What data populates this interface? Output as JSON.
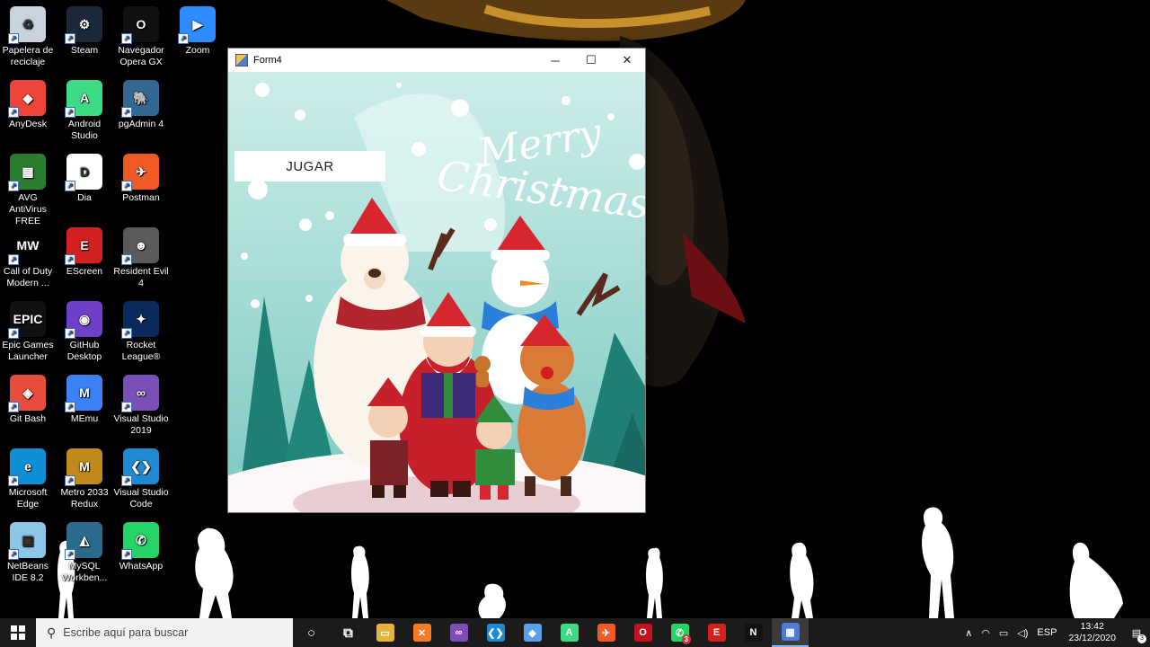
{
  "desktop": {
    "icons": [
      {
        "label": "Papelera de reciclaje",
        "icon": "recycle-bin-icon",
        "color": "#c9d3dc"
      },
      {
        "label": "Steam",
        "icon": "steam-icon",
        "color": "#1b2838"
      },
      {
        "label": "Navegador Opera GX",
        "icon": "opera-gx-icon",
        "color": "#111111"
      },
      {
        "label": "Zoom",
        "icon": "zoom-icon",
        "color": "#2d8cff"
      },
      {
        "label": "AnyDesk",
        "icon": "anydesk-icon",
        "color": "#ef443b"
      },
      {
        "label": "Android Studio",
        "icon": "android-studio-icon",
        "color": "#3ddc84"
      },
      {
        "label": "pgAdmin 4",
        "icon": "pgadmin-icon",
        "color": "#336791"
      },
      {
        "label": "AVG AntiVirus FREE",
        "icon": "avg-icon",
        "color": "#2a7d2f"
      },
      {
        "label": "Dia",
        "icon": "dia-icon",
        "color": "#ffffff"
      },
      {
        "label": "Postman",
        "icon": "postman-icon",
        "color": "#ef5b25"
      },
      {
        "label": "Call of Duty Modern ...",
        "icon": "call-of-duty-icon",
        "color": "#000000"
      },
      {
        "label": "EScreen",
        "icon": "escreen-icon",
        "color": "#d21f1f"
      },
      {
        "label": "Resident Evil 4",
        "icon": "resident-evil-icon",
        "color": "#5a5a5a"
      },
      {
        "label": "Epic Games Launcher",
        "icon": "epic-games-icon",
        "color": "#111111"
      },
      {
        "label": "GitHub Desktop",
        "icon": "github-desktop-icon",
        "color": "#6e40c9"
      },
      {
        "label": "Rocket League®",
        "icon": "rocket-league-icon",
        "color": "#0a2a5c"
      },
      {
        "label": "Git Bash",
        "icon": "git-bash-icon",
        "color": "#e74c3c"
      },
      {
        "label": "MEmu",
        "icon": "memu-icon",
        "color": "#3b82f6"
      },
      {
        "label": "Visual Studio 2019",
        "icon": "visual-studio-icon",
        "color": "#7b4fb8"
      },
      {
        "label": "Microsoft Edge",
        "icon": "edge-icon",
        "color": "#0f8fd8"
      },
      {
        "label": "Metro 2033 Redux",
        "icon": "metro-icon",
        "color": "#c28a1c"
      },
      {
        "label": "Visual Studio Code",
        "icon": "vscode-icon",
        "color": "#1f8ad2"
      },
      {
        "label": "NetBeans IDE 8.2",
        "icon": "netbeans-icon",
        "color": "#8ec6e8"
      },
      {
        "label": "MySQL Workben...",
        "icon": "mysql-workbench-icon",
        "color": "#2a6b8c"
      },
      {
        "label": "WhatsApp",
        "icon": "whatsapp-icon",
        "color": "#25d366"
      }
    ]
  },
  "window": {
    "title": "Form4",
    "minimize": "─",
    "maximize": "☐",
    "close": "✕",
    "button_label": "JUGAR",
    "banner_line1": "Merry",
    "banner_line2": "Christmas"
  },
  "taskbar": {
    "search_placeholder": "Escribe aquí para buscar",
    "apps": [
      {
        "icon": "cortana-icon",
        "glyph": "○",
        "bg": "transparent"
      },
      {
        "icon": "task-view-icon",
        "glyph": "⧉",
        "bg": "transparent"
      },
      {
        "icon": "file-explorer-icon",
        "glyph": "▭",
        "bg": "#e8b23a"
      },
      {
        "icon": "xampp-icon",
        "glyph": "✕",
        "bg": "#f57c20"
      },
      {
        "icon": "visual-studio-taskbar-icon",
        "glyph": "∞",
        "bg": "#7b4fb8"
      },
      {
        "icon": "vscode-taskbar-icon",
        "glyph": "❮❯",
        "bg": "#1f8ad2"
      },
      {
        "icon": "virtualbox-icon",
        "glyph": "◆",
        "bg": "#5aa0e8"
      },
      {
        "icon": "android-studio-taskbar-icon",
        "glyph": "A",
        "bg": "#3ddc84"
      },
      {
        "icon": "postman-taskbar-icon",
        "glyph": "✈",
        "bg": "#ef5b25"
      },
      {
        "icon": "opera-gx-taskbar-icon",
        "glyph": "O",
        "bg": "#c5121e"
      },
      {
        "icon": "whatsapp-taskbar-icon",
        "glyph": "✆",
        "bg": "#25d366",
        "badge": "3"
      },
      {
        "icon": "escreen-taskbar-icon",
        "glyph": "E",
        "bg": "#d21f1f"
      },
      {
        "icon": "netflix-icon",
        "glyph": "N",
        "bg": "#111111"
      },
      {
        "icon": "form4-taskbar-icon",
        "glyph": "▦",
        "bg": "#4e7bd6",
        "active": true
      }
    ],
    "tray": {
      "chevron": "∧",
      "language": "ESP",
      "time": "13:42",
      "date": "23/12/2020",
      "notifications": "3"
    }
  },
  "colors": {
    "taskbar_bg": "#1b1b1b",
    "window_bg": "#aee0dc",
    "accent": "#7fb2f0"
  }
}
